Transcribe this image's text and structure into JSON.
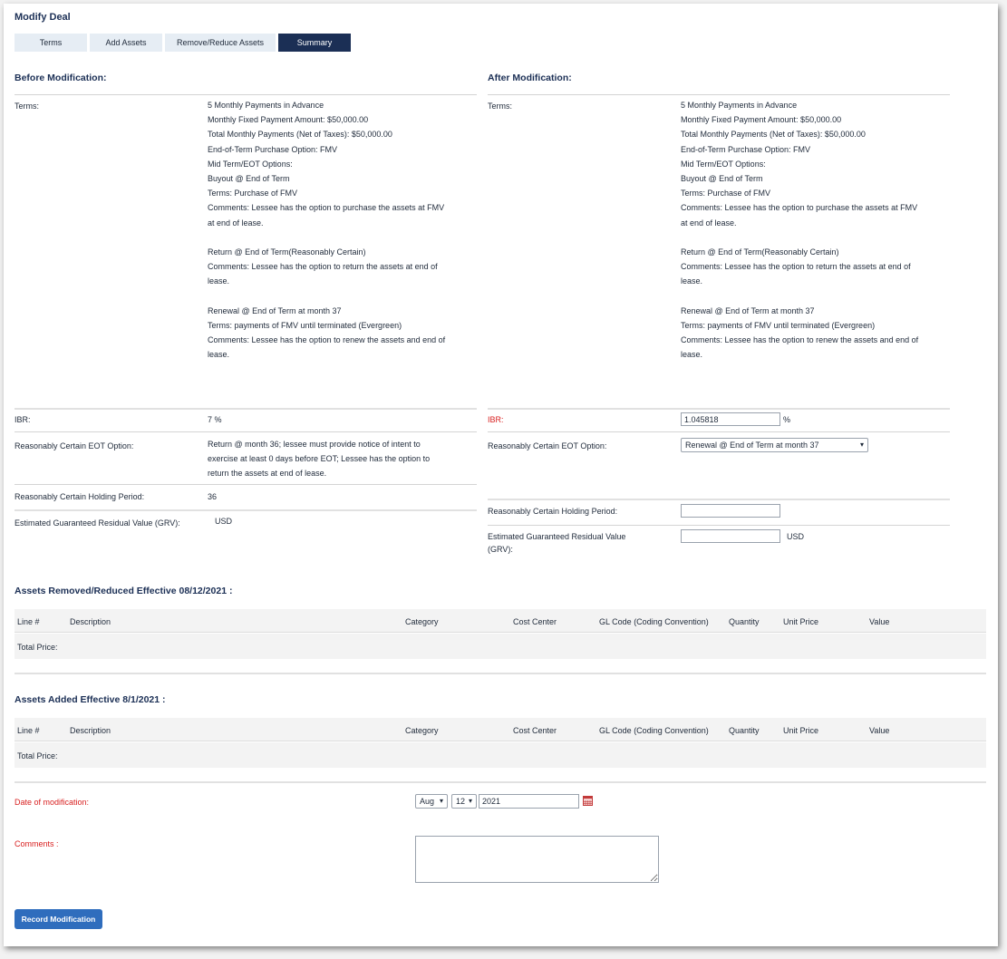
{
  "page": {
    "title": "Modify Deal",
    "tabs": [
      "Terms",
      "Add Assets",
      "Remove/Reduce Assets",
      "Summary"
    ]
  },
  "before": {
    "heading": "Before Modification:",
    "terms_label": "Terms:",
    "terms_lines": [
      "5 Monthly Payments in Advance",
      "Monthly Fixed Payment Amount: $50,000.00",
      "Total Monthly Payments (Net of Taxes): $50,000.00",
      "End-of-Term Purchase Option: FMV",
      "Mid Term/EOT Options:",
      "Buyout @ End of Term",
      "Terms: Purchase of FMV",
      "Comments: Lessee has the option to purchase the assets at FMV",
      "at end of lease.",
      "",
      "Return @ End of Term(Reasonably Certain)",
      "Comments: Lessee has the option to return the assets at end of",
      "lease.",
      "",
      "Renewal @ End of Term at month 37",
      "Terms: payments of FMV until terminated (Evergreen)",
      "Comments: Lessee has the option to renew the assets and end of",
      "lease."
    ],
    "ibr_label": "IBR:",
    "ibr_value": "7 %",
    "eot_label": "Reasonably Certain EOT Option:",
    "eot_lines": [
      "Return @ month 36; lessee must provide notice of intent to",
      "exercise at least 0 days before EOT; Lessee has the option to",
      "return the assets at end of lease."
    ],
    "holding_label": "Reasonably Certain Holding Period:",
    "holding_value": "36",
    "grv_label": "Estimated Guaranteed Residual Value (GRV):",
    "grv_value": "USD"
  },
  "after": {
    "heading": "After Modification:",
    "terms_label": "Terms:",
    "terms_lines": [
      "5 Monthly Payments in Advance",
      "Monthly Fixed Payment Amount: $50,000.00",
      "Total Monthly Payments (Net of Taxes): $50,000.00",
      "End-of-Term Purchase Option: FMV",
      "Mid Term/EOT Options:",
      "Buyout @ End of Term",
      "Terms: Purchase of FMV",
      "Comments: Lessee has the option to purchase the assets at FMV",
      "at end of lease.",
      "",
      "Return @ End of Term(Reasonably Certain)",
      "Comments: Lessee has the option to return the assets at end of",
      "lease.",
      "",
      "Renewal @ End of Term at month 37",
      "Terms: payments of FMV until terminated (Evergreen)",
      "Comments: Lessee has the option to renew the assets and end of",
      "lease."
    ],
    "ibr_label": "IBR:",
    "ibr_value": "1.045818",
    "ibr_unit": "%",
    "eot_label": "Reasonably Certain EOT Option:",
    "eot_selected": "Renewal @ End of Term at month 37",
    "holding_label": "Reasonably Certain Holding Period:",
    "holding_value": "",
    "grv_label_1": "Estimated Guaranteed Residual Value",
    "grv_label_2": "(GRV):",
    "grv_value": "",
    "grv_unit": "USD"
  },
  "removed": {
    "heading": "Assets Removed/Reduced Effective 08/12/2021 :",
    "columns": [
      "Line #",
      "Description",
      "Category",
      "Cost Center",
      "GL Code (Coding Convention)",
      "Quantity",
      "Unit Price",
      "Value"
    ],
    "total_label": "Total Price:"
  },
  "added": {
    "heading": "Assets Added Effective 8/1/2021 :",
    "columns": [
      "Line #",
      "Description",
      "Category",
      "Cost Center",
      "GL Code (Coding Convention)",
      "Quantity",
      "Unit Price",
      "Value"
    ],
    "total_label": "Total Price:"
  },
  "form": {
    "date_label": "Date of modification:",
    "month": "Aug",
    "day": "12",
    "year": "2021",
    "comments_label": "Comments :",
    "comments_value": "",
    "record_button": "Record Modification"
  },
  "colors": {
    "navy": "#1b2f55",
    "tab_bg": "#e6edf4",
    "required_red": "#d81f1f",
    "button_blue": "#2f6dbd"
  }
}
